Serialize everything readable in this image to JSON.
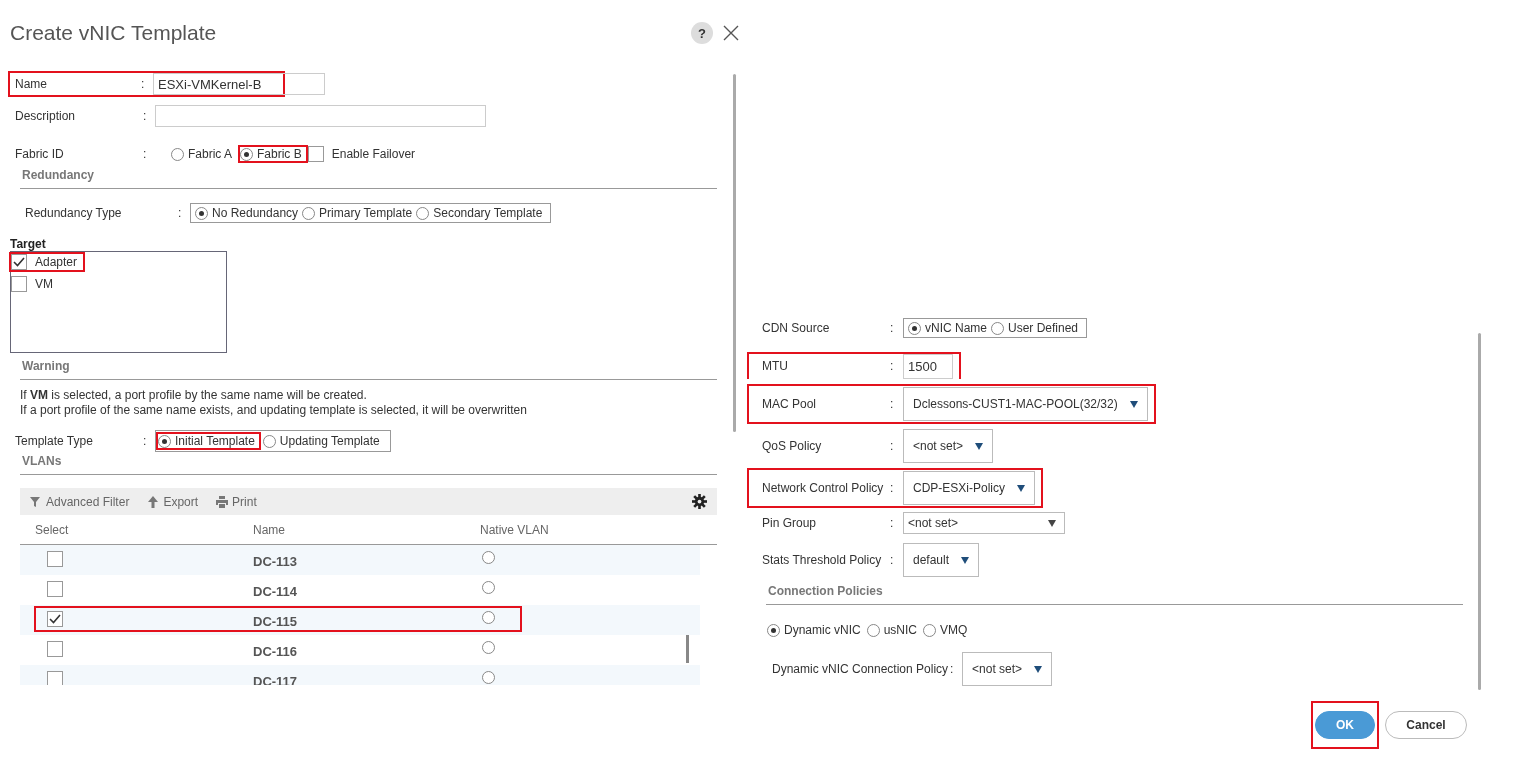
{
  "dialog": {
    "title": "Create vNIC Template",
    "help_label": "?"
  },
  "separator": ":",
  "left": {
    "name": {
      "label": "Name",
      "value": "ESXi-VMKernel-B",
      "highlighted": true
    },
    "description": {
      "label": "Description"
    },
    "fabric_id": {
      "label": "Fabric ID",
      "options": [
        {
          "label": "Fabric A",
          "selected": false,
          "highlighted": false
        },
        {
          "label": "Fabric B",
          "selected": true,
          "highlighted": true
        }
      ],
      "failover": {
        "label": "Enable Failover",
        "checked": false
      }
    },
    "redundancy": {
      "heading": "Redundancy",
      "label": "Redundancy Type",
      "options": [
        {
          "label": "No Redundancy",
          "selected": true
        },
        {
          "label": "Primary Template",
          "selected": false
        },
        {
          "label": "Secondary Template",
          "selected": false
        }
      ]
    },
    "target": {
      "heading": "Target",
      "items": [
        {
          "label": "Adapter",
          "checked": true,
          "highlighted": true
        },
        {
          "label": "VM",
          "checked": false,
          "highlighted": false
        }
      ]
    },
    "warning": {
      "heading": "Warning",
      "lines": [
        "If **VM** is selected, a port profile by the same name will be created.",
        "If a port profile of the same name exists, and updating template is selected, it will be overwritten"
      ]
    },
    "template_type": {
      "label": "Template Type",
      "options": [
        {
          "label": "Initial Template",
          "selected": true,
          "highlighted": true
        },
        {
          "label": "Updating Template",
          "selected": false,
          "highlighted": false
        }
      ]
    },
    "vlans": {
      "heading": "VLANs",
      "toolbar": [
        {
          "kind": "filter",
          "label": "Advanced Filter"
        },
        {
          "kind": "export",
          "label": "Export"
        },
        {
          "kind": "print",
          "label": "Print"
        }
      ],
      "columns": [
        "Select",
        "Name",
        "Native VLAN"
      ],
      "rows": [
        {
          "name": "DC-113",
          "checked": false,
          "native": false,
          "highlighted": false
        },
        {
          "name": "DC-114",
          "checked": false,
          "native": false,
          "highlighted": false
        },
        {
          "name": "DC-115",
          "checked": true,
          "native": false,
          "highlighted": true
        },
        {
          "name": "DC-116",
          "checked": false,
          "native": false,
          "highlighted": false
        },
        {
          "name": "DC-117",
          "checked": false,
          "native": false,
          "highlighted": false
        }
      ]
    }
  },
  "right": {
    "rows": [
      {
        "kind": "radio",
        "label": "CDN Source",
        "highlighted": false,
        "options": [
          {
            "label": "vNIC Name",
            "selected": true
          },
          {
            "label": "User Defined",
            "selected": false
          }
        ]
      },
      {
        "kind": "input",
        "label": "MTU",
        "value": "1500",
        "highlighted": true
      },
      {
        "kind": "select",
        "label": "MAC Pool",
        "value": "Dclessons-CUST1-MAC-POOL(32/32)",
        "highlighted": true
      },
      {
        "kind": "select",
        "label": "QoS Policy",
        "value": "<not set>",
        "highlighted": false
      },
      {
        "kind": "select",
        "label": "Network Control Policy",
        "value": "CDP-ESXi-Policy",
        "highlighted": true
      },
      {
        "kind": "wide_select",
        "label": "Pin Group",
        "value": "<not set>",
        "highlighted": false
      },
      {
        "kind": "select",
        "label": "Stats Threshold Policy",
        "value": "default",
        "highlighted": false
      }
    ],
    "connection": {
      "heading": "Connection Policies",
      "options": [
        {
          "label": "Dynamic vNIC",
          "selected": true
        },
        {
          "label": "usNIC",
          "selected": false
        },
        {
          "label": "VMQ",
          "selected": false
        }
      ],
      "policy": {
        "label": "Dynamic vNIC Connection Policy",
        "value": "<not set>"
      }
    },
    "buttons": [
      {
        "kind": "primary",
        "label": "OK",
        "highlighted": true
      },
      {
        "kind": "secondary",
        "label": "Cancel",
        "highlighted": false
      }
    ]
  }
}
